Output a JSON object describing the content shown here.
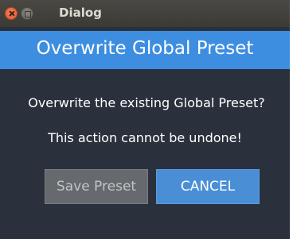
{
  "window": {
    "title": "Dialog"
  },
  "dialog": {
    "header": "Overwrite Global Preset",
    "message": "Overwrite the existing Global Preset?",
    "warning": "This action cannot be undone!",
    "buttons": {
      "save_label": "Save Preset",
      "cancel_label": "CANCEL"
    }
  },
  "colors": {
    "background": "#2a313d",
    "header": "#3d8ee0",
    "cancel_button": "#4a8fd6",
    "save_button": "#66696e"
  }
}
